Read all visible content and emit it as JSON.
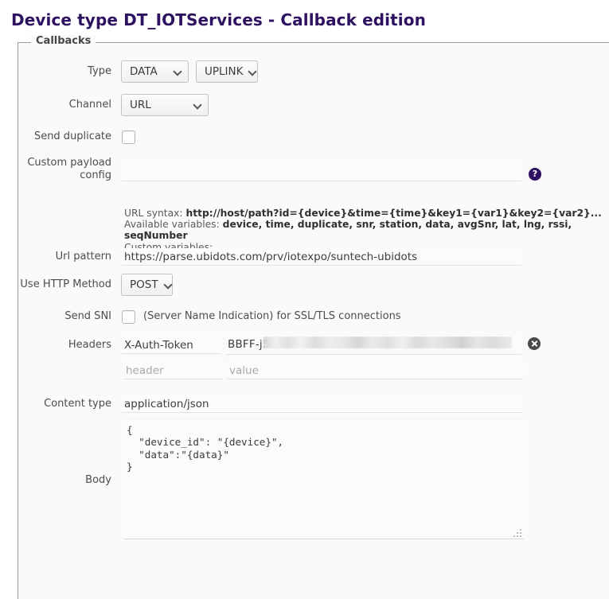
{
  "page": {
    "title": "Device type DT_IOTServices - Callback edition"
  },
  "fieldset": {
    "legend": "Callbacks"
  },
  "form": {
    "type": {
      "label": "Type",
      "category_value": "DATA",
      "direction_value": "UPLINK"
    },
    "channel": {
      "label": "Channel",
      "value": "URL"
    },
    "send_duplicate": {
      "label": "Send duplicate",
      "checked": false
    },
    "custom_payload_config": {
      "label": "Custom payload config",
      "label_line1": "Custom payload",
      "label_line2": "config",
      "value": "",
      "placeholder": "",
      "help_icon": "help-icon",
      "help_glyph": "?"
    },
    "hints": {
      "url_syntax_prefix": "URL syntax: ",
      "url_syntax_value": "http://host/path?id={device}&time={time}&key1={var1}&key2={var2}...",
      "available_prefix": "Available variables: ",
      "available_value": "device, time, duplicate, snr, station, data, avgSnr, lat, lng, rssi, seqNumber",
      "custom_variables": "Custom variables:"
    },
    "url_pattern": {
      "label": "Url pattern",
      "value": "https://parse.ubidots.com/prv/iotexpo/suntech-ubidots"
    },
    "http_method": {
      "label": "Use HTTP Method",
      "value": "POST"
    },
    "send_sni": {
      "label": "Send SNI",
      "description": "(Server Name Indication) for SSL/TLS connections",
      "checked": false
    },
    "headers": {
      "label": "Headers",
      "rows": [
        {
          "name": "X-Auth-Token",
          "value_visible_prefix": "BBFF-j5",
          "value_redacted": true,
          "delete_icon": "delete-icon"
        },
        {
          "name": "",
          "value": "",
          "name_placeholder": "header",
          "value_placeholder": "value"
        }
      ]
    },
    "content_type": {
      "label": "Content type",
      "value": "application/json"
    },
    "body": {
      "label": "Body",
      "value": "{\n  \"device_id\": \"{device}\",\n  \"data\":\"{data}\"\n}"
    }
  },
  "colors": {
    "title": "#2e1261",
    "accent": "#2e1261",
    "panel_bg": "#fafafa",
    "border": "#9a9a9a"
  }
}
